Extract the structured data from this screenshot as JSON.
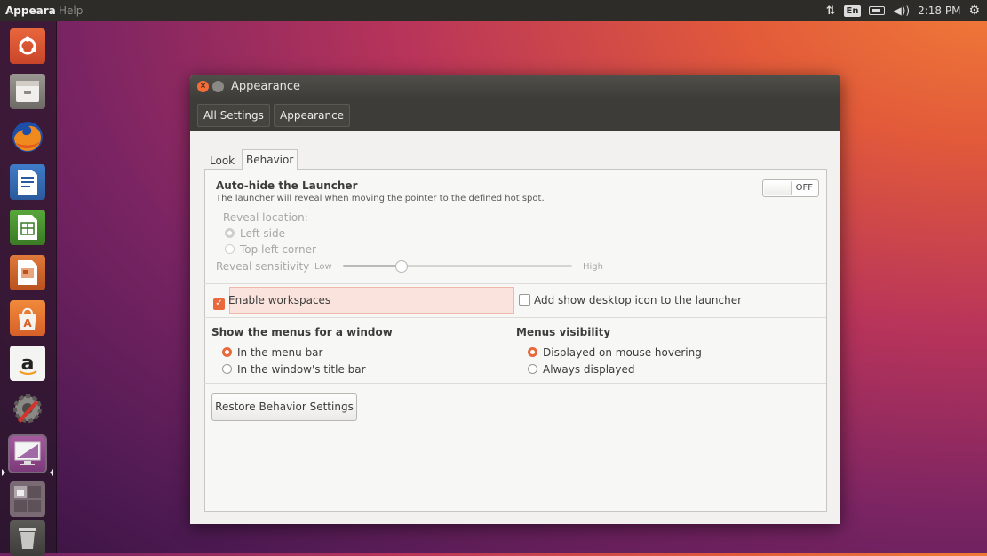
{
  "topbar": {
    "app_menu_visible": "Appeara",
    "app_menu_faded": "",
    "help_label": "Help",
    "lang_indicator": "En",
    "clock": "2:18 PM"
  },
  "launcher": {
    "items": [
      {
        "name": "dash-icon"
      },
      {
        "name": "files-icon"
      },
      {
        "name": "firefox-icon"
      },
      {
        "name": "writer-icon"
      },
      {
        "name": "calc-icon"
      },
      {
        "name": "impress-icon"
      },
      {
        "name": "software-center-icon"
      },
      {
        "name": "amazon-icon"
      },
      {
        "name": "system-settings-icon"
      },
      {
        "name": "appearance-icon"
      },
      {
        "name": "workspace-switcher-icon"
      },
      {
        "name": "trash-icon"
      }
    ]
  },
  "window": {
    "title": "Appearance",
    "breadcrumbs": [
      "All Settings",
      "Appearance"
    ],
    "tabs": {
      "look": "Look",
      "behavior": "Behavior"
    },
    "autohide": {
      "title": "Auto-hide the Launcher",
      "description": "The launcher will reveal when moving the pointer to the defined hot spot.",
      "toggle_state": "OFF",
      "reveal_location_label": "Reveal location:",
      "left_side": "Left side",
      "top_left_corner": "Top left corner",
      "sensitivity_label": "Reveal sensitivity",
      "low": "Low",
      "high": "High",
      "sensitivity_level": 0.25
    },
    "workspaces": {
      "enable_label": "Enable workspaces",
      "desktop_icon_label": "Add show desktop icon to the launcher"
    },
    "menus": {
      "show_menus_title": "Show the menus for a window",
      "in_menu_bar": "In the menu bar",
      "in_title_bar": "In the window's title bar",
      "visibility_title": "Menus visibility",
      "on_hover": "Displayed on mouse hovering",
      "always": "Always displayed"
    },
    "restore_button": "Restore Behavior Settings"
  },
  "colors": {
    "accent": "#e9683c",
    "panel_bg": "#2d2c28"
  }
}
